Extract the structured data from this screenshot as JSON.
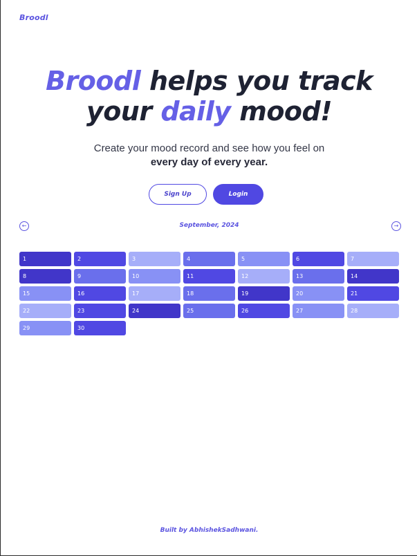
{
  "brand": "Broodl",
  "hero": {
    "brand": "Broodl",
    "line1_rest": "helps you track",
    "line2_start": "your",
    "line2_accent": "daily",
    "line2_end": "mood!"
  },
  "subtitle": {
    "line1": "Create your mood record and see how you feel on",
    "line2": "every day of every year."
  },
  "buttons": {
    "signup": "Sign Up",
    "login": "Login"
  },
  "calendar": {
    "month_label": "September, 2024",
    "prev_icon": "arrow-left-icon",
    "next_icon": "arrow-right-icon",
    "colors": {
      "level1": "#a6aef9",
      "level2": "#8891f5",
      "level3": "#6a6fec",
      "level4": "#5048e3",
      "level5": "#4136c9"
    },
    "days": [
      {
        "label": "1",
        "level": 5
      },
      {
        "label": "2",
        "level": 4
      },
      {
        "label": "3",
        "level": 1
      },
      {
        "label": "4",
        "level": 3
      },
      {
        "label": "5",
        "level": 2
      },
      {
        "label": "6",
        "level": 4
      },
      {
        "label": "7",
        "level": 1
      },
      {
        "label": "8",
        "level": 5
      },
      {
        "label": "9",
        "level": 3
      },
      {
        "label": "10",
        "level": 2
      },
      {
        "label": "11",
        "level": 4
      },
      {
        "label": "12",
        "level": 1
      },
      {
        "label": "13",
        "level": 3
      },
      {
        "label": "14",
        "level": 5
      },
      {
        "label": "15",
        "level": 2
      },
      {
        "label": "16",
        "level": 4
      },
      {
        "label": "17",
        "level": 1
      },
      {
        "label": "18",
        "level": 3
      },
      {
        "label": "19",
        "level": 5
      },
      {
        "label": "20",
        "level": 2
      },
      {
        "label": "21",
        "level": 4
      },
      {
        "label": "22",
        "level": 1
      },
      {
        "label": "23",
        "level": 4
      },
      {
        "label": "24",
        "level": 5
      },
      {
        "label": "25",
        "level": 3
      },
      {
        "label": "26",
        "level": 4
      },
      {
        "label": "27",
        "level": 2
      },
      {
        "label": "28",
        "level": 1
      },
      {
        "label": "29",
        "level": 2
      },
      {
        "label": "30",
        "level": 4
      }
    ]
  },
  "footer": "Built by AbhishekSadhwani."
}
